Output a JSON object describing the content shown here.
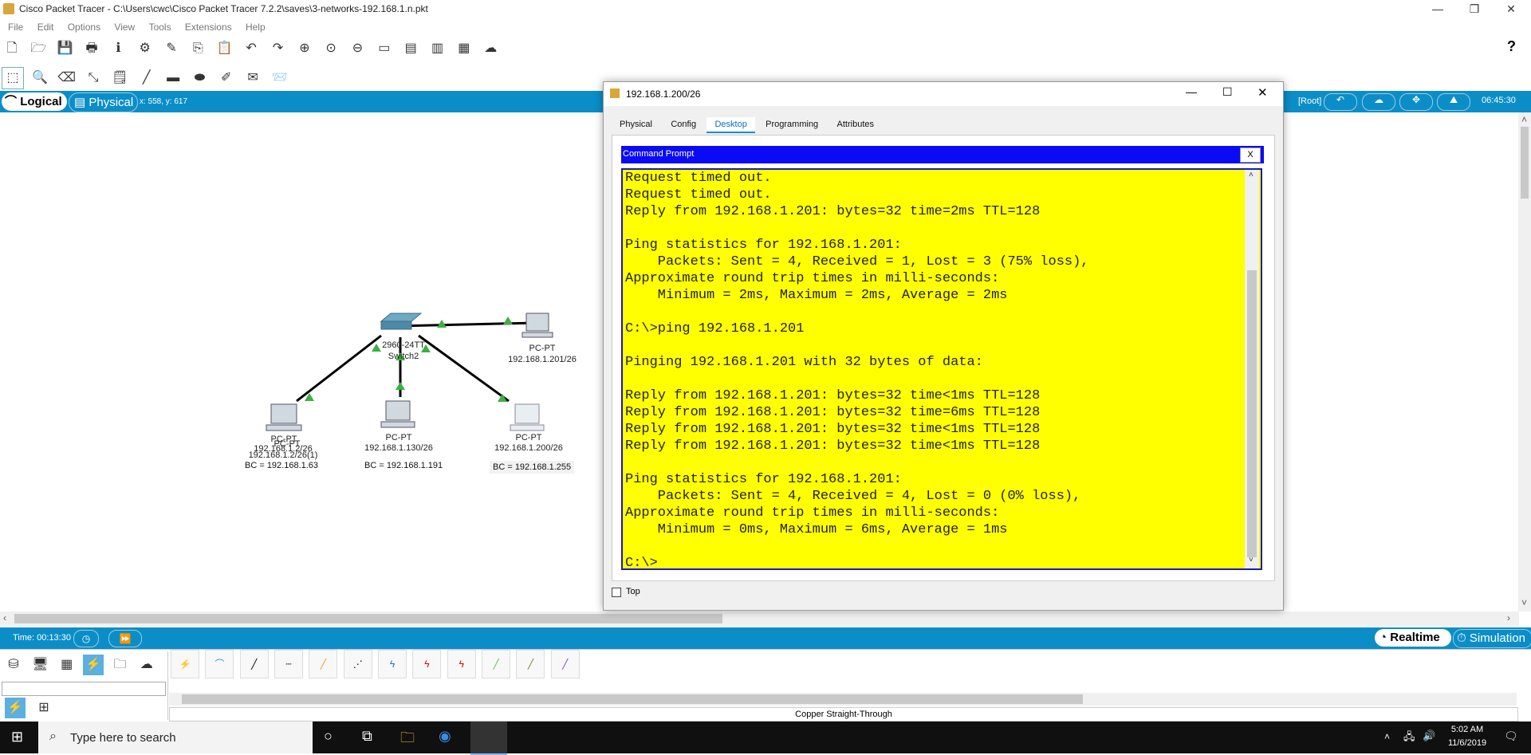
{
  "window": {
    "title": "Cisco Packet Tracer - C:\\Users\\cwc\\Cisco Packet Tracer 7.2.2\\saves\\3-networks-192.168.1.n.pkt"
  },
  "menu": [
    "File",
    "Edit",
    "Options",
    "View",
    "Tools",
    "Extensions",
    "Help"
  ],
  "workspace_tabs": {
    "logical": "Logical",
    "physical": "Physical",
    "coords": "x: 558, y: 617"
  },
  "right_strip": {
    "root": "[Root]",
    "clock": "06:45:30"
  },
  "topology": {
    "switch": {
      "model": "2960-24TT",
      "name": "Switch2"
    },
    "devices": [
      {
        "type": "PC-PT",
        "label": "192.168.1.201/26"
      },
      {
        "type": "PC-PT",
        "label": "PC-PT",
        "label2": "192.168.1.2/26",
        "label3": "192.168.1.2/26(1)",
        "bc": "BC = 192.168.1.63"
      },
      {
        "type": "PC-PT",
        "label": "192.168.1.130/26",
        "bc": "BC = 192.168.1.191"
      },
      {
        "type": "PC-PT",
        "label": "192.168.1.200/26",
        "bc": "BC = 192.168.1.255"
      }
    ]
  },
  "dialog": {
    "title": "192.168.1.200/26",
    "tabs": [
      "Physical",
      "Config",
      "Desktop",
      "Programming",
      "Attributes"
    ],
    "cmd_title": "Command Prompt",
    "close_label": "X",
    "top_checkbox": "Top",
    "terminal_lines": [
      "Request timed out.",
      "Request timed out.",
      "Reply from 192.168.1.201: bytes=32 time=2ms TTL=128",
      "",
      "Ping statistics for 192.168.1.201:",
      "    Packets: Sent = 4, Received = 1, Lost = 3 (75% loss),",
      "Approximate round trip times in milli-seconds:",
      "    Minimum = 2ms, Maximum = 2ms, Average = 2ms",
      "",
      "C:\\>ping 192.168.1.201",
      "",
      "Pinging 192.168.1.201 with 32 bytes of data:",
      "",
      "Reply from 192.168.1.201: bytes=32 time<1ms TTL=128",
      "Reply from 192.168.1.201: bytes=32 time=6ms TTL=128",
      "Reply from 192.168.1.201: bytes=32 time<1ms TTL=128",
      "Reply from 192.168.1.201: bytes=32 time<1ms TTL=128",
      "",
      "Ping statistics for 192.168.1.201:",
      "    Packets: Sent = 4, Received = 4, Lost = 0 (0% loss),",
      "Approximate round trip times in milli-seconds:",
      "    Minimum = 0ms, Maximum = 6ms, Average = 1ms",
      "",
      "C:\\>"
    ]
  },
  "bottom": {
    "time": "Time: 00:13:30",
    "realtime": "Realtime",
    "simulation": "Simulation",
    "connection_label": "Copper Straight-Through"
  },
  "taskbar": {
    "search_placeholder": "Type here to search",
    "time": "5:02 AM",
    "date": "11/6/2019"
  },
  "colors": {
    "accent": "#0b8ec8",
    "terminal_bg": "#ffff00",
    "cmd_header": "#0b0bf3"
  }
}
